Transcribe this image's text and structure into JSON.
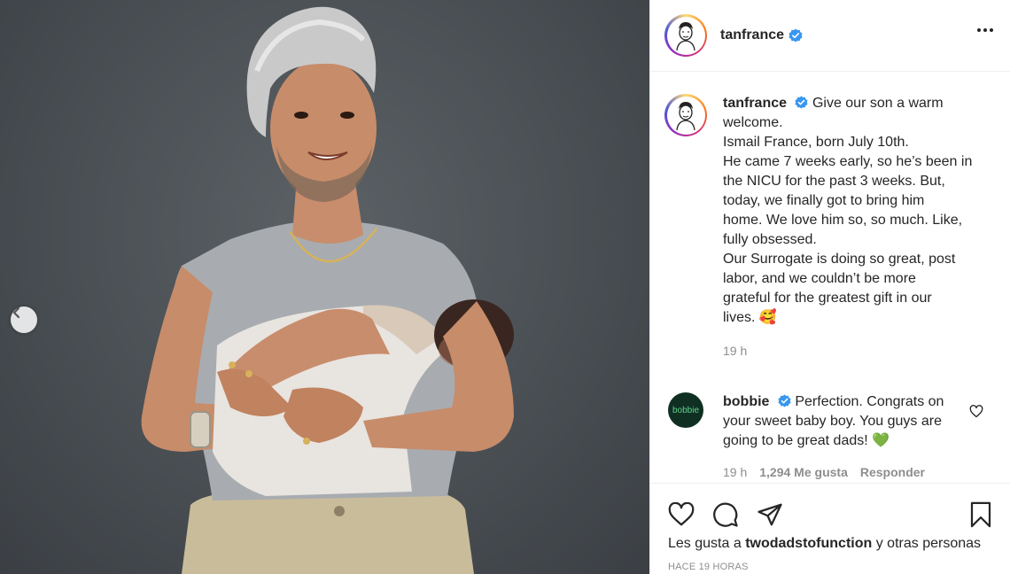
{
  "post": {
    "username": "tanfrance",
    "caption_lines": [
      "Give our son a warm",
      "welcome.",
      "Ismail France, born July 10th.",
      "He came 7 weeks early, so he’s been in",
      "the NICU for the past 3 weeks. But,",
      "today, we finally got to bring him",
      "home. We love him so, so much. Like,",
      "fully obsessed.",
      "Our Surrogate is doing so great, post",
      "labor, and we couldn’t be more",
      "grateful for the greatest gift in our",
      "lives. 🥰"
    ],
    "caption_time": "19 h"
  },
  "comment": {
    "username": "bobbie",
    "avatar_text": "bobbie",
    "text": "Perfection. Congrats on your sweet baby boy. You guys are going to be great dads! 💚",
    "time": "19 h",
    "likes": "1,294 Me gusta",
    "reply": "Responder"
  },
  "likes": {
    "prefix": "Les gusta a",
    "user": "twodadstofunction",
    "suffix": "y otras personas"
  },
  "timestamp": "HACE 19 HORAS",
  "colors": {
    "verified": "#3897f0",
    "text": "#262626",
    "secondary": "#8e8e8e",
    "bobbie_bg": "#0f2f23"
  },
  "icons": [
    "verified-badge-icon",
    "more-options-icon",
    "heart-icon",
    "comment-icon",
    "share-icon",
    "bookmark-icon",
    "chevron-left-icon"
  ]
}
